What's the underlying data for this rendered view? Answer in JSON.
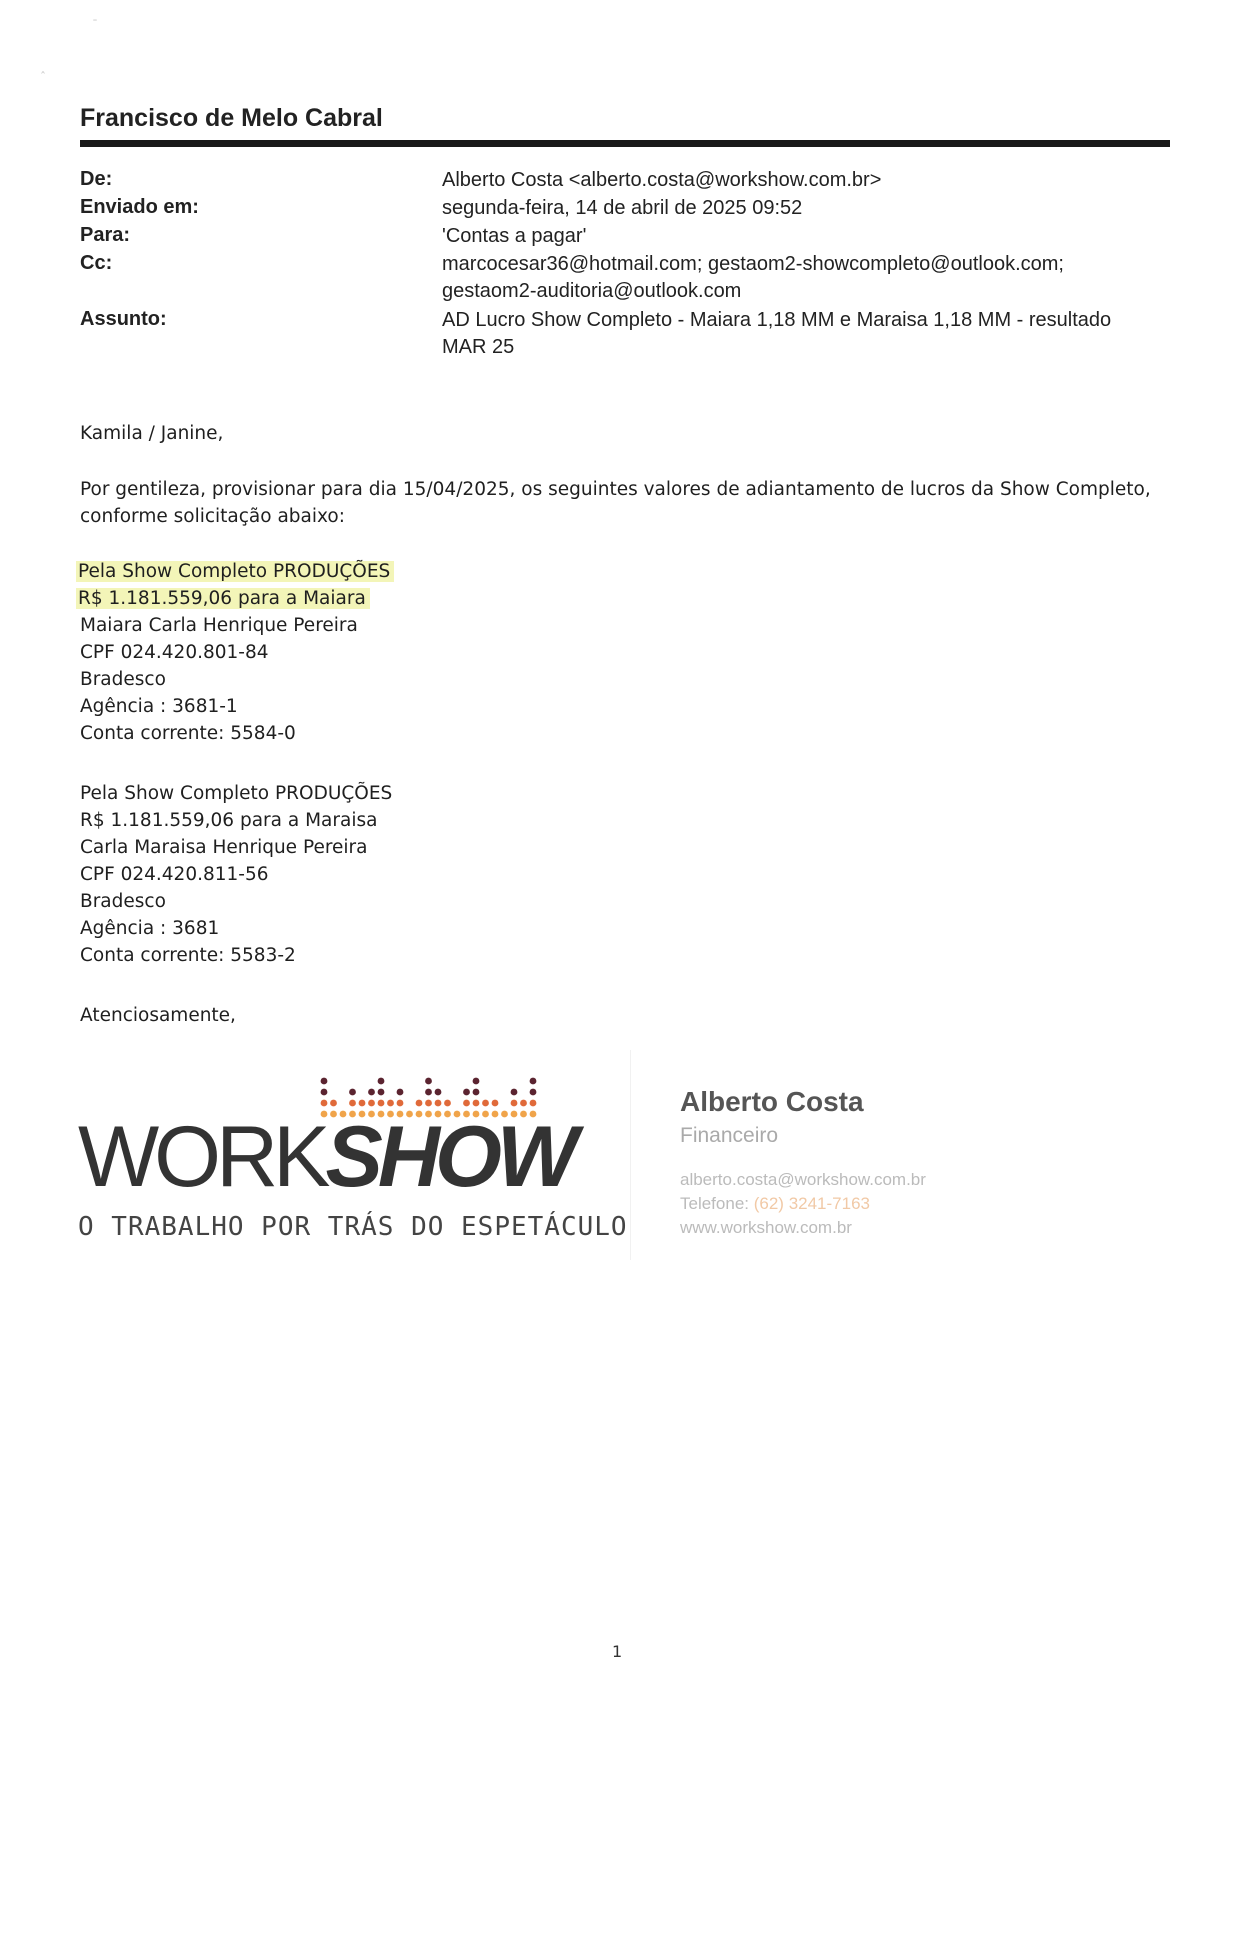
{
  "owner_name": "Francisco de Melo Cabral",
  "header": {
    "from": {
      "label": "De:",
      "value": "Alberto Costa <alberto.costa@workshow.com.br>"
    },
    "sent": {
      "label": "Enviado em:",
      "value": "segunda-feira, 14 de abril de 2025 09:52"
    },
    "to": {
      "label": "Para:",
      "value": "'Contas a pagar'"
    },
    "cc": {
      "label": "Cc:",
      "value_line1": "marcocesar36@hotmail.com; gestaom2-showcompleto@outlook.com;",
      "value_line2": "gestaom2-auditoria@outlook.com"
    },
    "subject": {
      "label": "Assunto:",
      "value_line1": "AD Lucro Show Completo - Maiara 1,18 MM e Maraisa 1,18 MM - resultado",
      "value_line2": "MAR 25"
    }
  },
  "body": {
    "greeting": "Kamila / Janine,",
    "intro_line1": "Por gentileza, provisionar para dia 15/04/2025, os seguintes valores de adiantamento de lucros da Show Completo,",
    "intro_line2": "conforme solicitação abaixo:",
    "payment1": {
      "company": "Pela Show Completo PRODUÇÕES",
      "amount": "R$ 1.181.559,06 para a Maiara",
      "name": "Maiara Carla Henrique Pereira",
      "cpf": "CPF 024.420.801-84",
      "bank": "Bradesco",
      "agency": "Agência : 3681-1",
      "account": "Conta corrente: 5584-0"
    },
    "payment2": {
      "company": "Pela Show Completo PRODUÇÕES",
      "amount": "R$ 1.181.559,06 para a Maraisa",
      "name": "Carla Maraisa Henrique Pereira",
      "cpf": "CPF 024.420.811-56",
      "bank": "Bradesco",
      "agency": "Agência : 3681",
      "account": "Conta corrente: 5583-2"
    },
    "closing": "Atenciosamente,"
  },
  "signature": {
    "logo_work": "WORK",
    "logo_show": "SHOW",
    "logo_tagline": "O TRABALHO POR TRÁS DO ESPETÁCULO",
    "name": "Alberto Costa",
    "role": "Financeiro",
    "email": "alberto.costa@workshow.com.br",
    "phone_label": "Telefone:",
    "phone": "(62) 3241-7163",
    "website": "www.workshow.com.br"
  },
  "page_number": "1",
  "colors": {
    "highlight": "#f3f5b8",
    "logo_dots_dark": "#5b2430",
    "logo_dots_light": "#f0a44a",
    "phone_accent": "#f1c9a6"
  }
}
